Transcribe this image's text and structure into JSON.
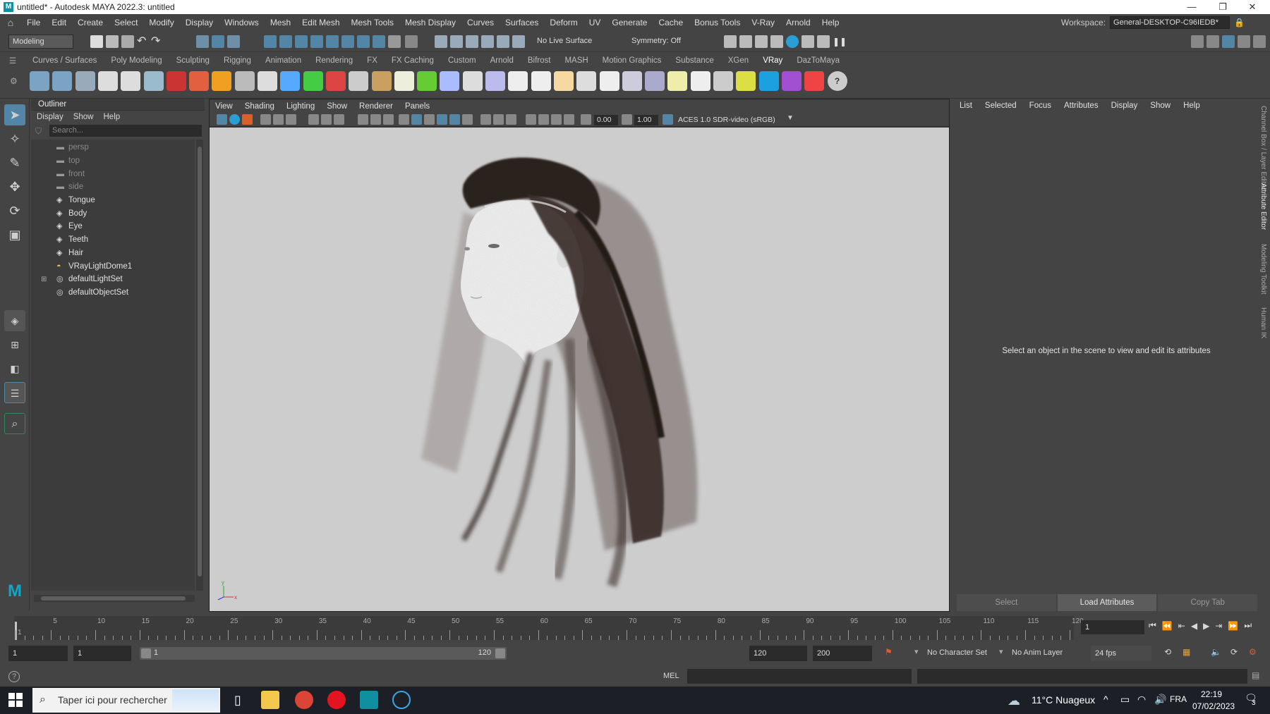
{
  "window": {
    "title": "untitled* - Autodesk MAYA 2022.3: untitled",
    "minimize_icon": "minimize-icon",
    "restore_icon": "restore-icon",
    "close_icon": "close-icon"
  },
  "menubar": {
    "items": [
      "File",
      "Edit",
      "Create",
      "Select",
      "Modify",
      "Display",
      "Windows",
      "Mesh",
      "Edit Mesh",
      "Mesh Tools",
      "Mesh Display",
      "Curves",
      "Surfaces",
      "Deform",
      "UV",
      "Generate",
      "Cache",
      "Bonus Tools",
      "V-Ray",
      "Arnold",
      "Help"
    ],
    "workspace_label": "Workspace:",
    "workspace_value": "General-DESKTOP-C96IEDB*"
  },
  "statusline": {
    "mode": "Modeling",
    "live_surface": "No Live Surface",
    "symmetry": "Symmetry: Off"
  },
  "shelf": {
    "tabs": [
      "Curves / Surfaces",
      "Poly Modeling",
      "Sculpting",
      "Rigging",
      "Animation",
      "Rendering",
      "FX",
      "FX Caching",
      "Custom",
      "Arnold",
      "Bifrost",
      "MASH",
      "Motion Graphics",
      "Substance",
      "XGen",
      "VRay",
      "DazToMaya"
    ],
    "active_tab": "VRay"
  },
  "outliner": {
    "title": "Outliner",
    "menu": [
      "Display",
      "Show",
      "Help"
    ],
    "search_placeholder": "Search...",
    "items": [
      {
        "label": "persp",
        "type": "camera"
      },
      {
        "label": "top",
        "type": "camera"
      },
      {
        "label": "front",
        "type": "camera"
      },
      {
        "label": "side",
        "type": "camera"
      },
      {
        "label": "Tongue",
        "type": "mesh"
      },
      {
        "label": "Body",
        "type": "mesh"
      },
      {
        "label": "Eye",
        "type": "mesh"
      },
      {
        "label": "Teeth",
        "type": "mesh"
      },
      {
        "label": "Hair",
        "type": "mesh"
      },
      {
        "label": "VRayLightDome1",
        "type": "light"
      },
      {
        "label": "defaultLightSet",
        "type": "set",
        "expandable": true
      },
      {
        "label": "defaultObjectSet",
        "type": "set"
      }
    ]
  },
  "viewport": {
    "menu": [
      "View",
      "Shading",
      "Lighting",
      "Show",
      "Renderer",
      "Panels"
    ],
    "exposure": "0.00",
    "gamma": "1.00",
    "color_space": "ACES 1.0 SDR-video (sRGB)",
    "axis_y": "y",
    "axis_x": "x"
  },
  "attribute_editor": {
    "menu": [
      "List",
      "Selected",
      "Focus",
      "Attributes",
      "Display",
      "Show",
      "Help"
    ],
    "message": "Select an object in the scene to view and edit its attributes",
    "buttons": [
      "Select",
      "Load Attributes",
      "Copy Tab"
    ],
    "side_tabs": [
      "Channel Box / Layer Editor",
      "Attribute Editor",
      "Modeling Toolkit",
      "Human IK"
    ]
  },
  "timeslider": {
    "labels": [
      "1",
      "5",
      "10",
      "15",
      "20",
      "25",
      "30",
      "35",
      "40",
      "45",
      "50",
      "55",
      "60",
      "65",
      "70",
      "75",
      "80",
      "85",
      "90",
      "95",
      "100",
      "105",
      "110",
      "115",
      "120"
    ],
    "current_frame": "1",
    "range_start": 1,
    "range_end": 120
  },
  "rangeslider": {
    "start": "1",
    "playback_start": "1",
    "slider_start": "1",
    "slider_end": "120",
    "playback_end": "120",
    "end": "200",
    "character_set": "No Character Set",
    "anim_layer": "No Anim Layer",
    "fps": "24 fps"
  },
  "cmdline": {
    "lang": "MEL"
  },
  "taskbar": {
    "search_placeholder": "Taper ici pour rechercher",
    "weather": "11°C Nuageux",
    "lang": "FRA",
    "time": "22:19",
    "date": "07/02/2023",
    "notifications": "3"
  },
  "colors": {
    "accent": "#5285a6",
    "panel": "#444444",
    "viewport_bg": "#cdcdcd",
    "hair": "#2a201c"
  }
}
